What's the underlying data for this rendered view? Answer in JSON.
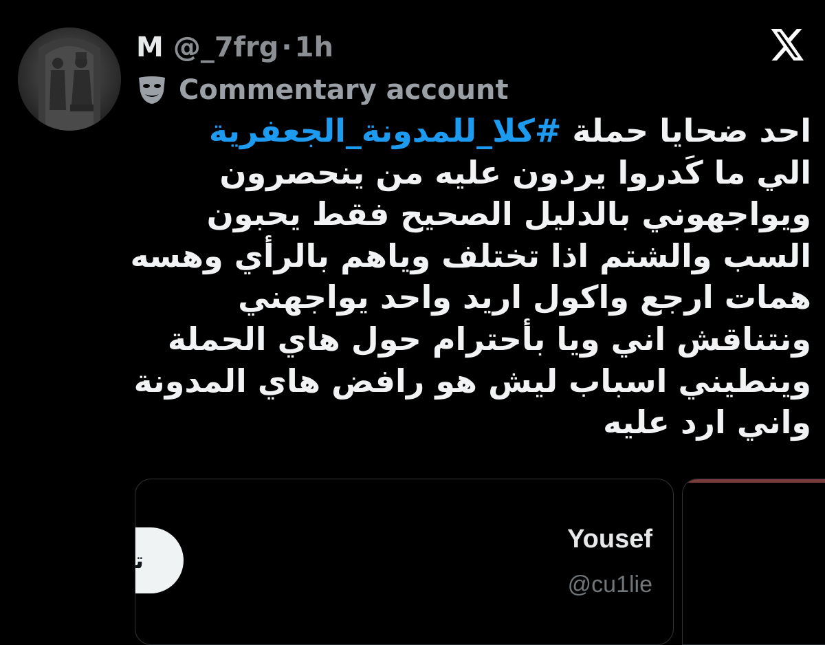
{
  "tweet": {
    "display_name": "M",
    "handle": "@_7frg",
    "separator": "·",
    "time": "1h",
    "account_label": "Commentary account",
    "hashtag": "#كلا_للمدونة_الجعفرية",
    "first_line_prefix": "احد ضحايا حملة ",
    "text_lines": [
      "الي ما كَدروا يردون عليه من ينحصرون",
      "ويواجهوني بالدليل الصحيح فقط يحبون",
      "السب والشتم اذا تختلف وياهم بالرأي وهسه",
      "همات ارجع واكول اريد واحد يواجهني",
      "ونتناقش اني ويا بأحترام حول هاي الحملة",
      "وينطيني اسباب ليش هو رافض هاي المدونة",
      "واني ارد عليه"
    ]
  },
  "quote_card": {
    "name": "Yousef",
    "handle": "@cu1lie",
    "follow_label": "تابِع"
  },
  "icons": {
    "platform": "x-logo-icon",
    "label": "theater-mask-icon",
    "avatar": "stone-relief-avatar"
  },
  "colors": {
    "background": "#000000",
    "hashtag": "#1d9bf0",
    "secondary_text": "#8b8f94"
  }
}
